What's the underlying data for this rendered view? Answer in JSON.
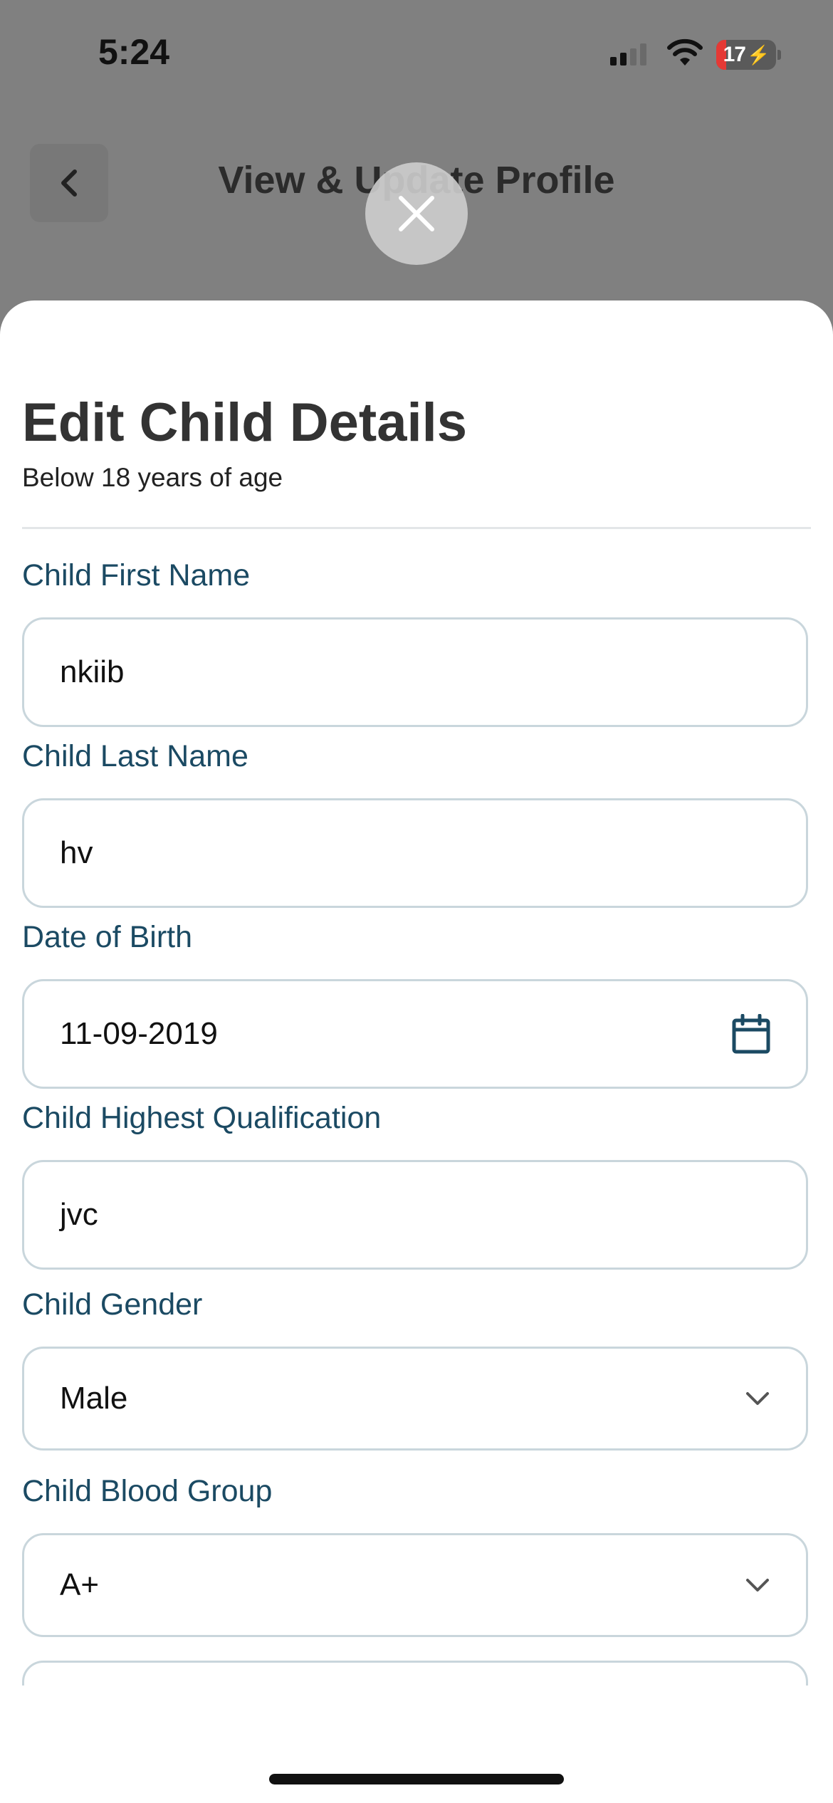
{
  "status_bar": {
    "time": "5:24",
    "battery_level": "17",
    "battery_fraction": 0.17,
    "icons": [
      "cellular-signal-icon",
      "wifi-icon",
      "battery-charging-icon"
    ]
  },
  "header": {
    "title": "View & Update Profile",
    "back_icon": "chevron-left-icon"
  },
  "modal": {
    "close_icon": "close-icon",
    "title": "Edit Child Details",
    "subtitle": "Below 18 years of age"
  },
  "form": {
    "first_name": {
      "label": "Child First Name",
      "value": "nkiib"
    },
    "last_name": {
      "label": "Child Last Name",
      "value": "hv"
    },
    "dob": {
      "label": "Date of Birth",
      "value": "11-09-2019",
      "icon": "calendar-icon"
    },
    "qualification": {
      "label": "Child Highest Qualification",
      "value": "jvc"
    },
    "gender": {
      "label": "Child Gender",
      "value": "Male",
      "icon": "chevron-down-icon"
    },
    "blood_group": {
      "label": "Child Blood Group",
      "value": "A+",
      "icon": "chevron-down-icon"
    }
  },
  "colors": {
    "label": "#1b4a63",
    "field_border": "#c9d6dc",
    "overlay": "#808080",
    "icon_accent": "#1b4a63"
  }
}
